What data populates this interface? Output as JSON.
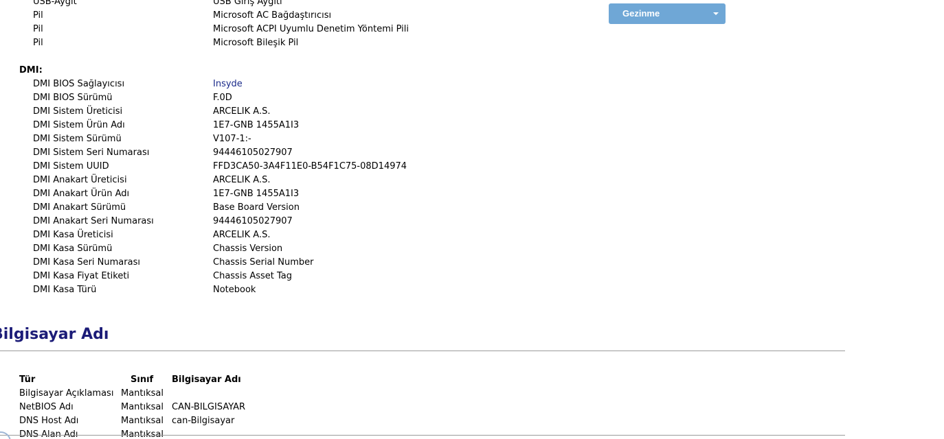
{
  "navigation": {
    "button_label": "Gezinme"
  },
  "devices": [
    {
      "key": "USB-Aygıt",
      "value": "USB Giriş Aygıtı"
    },
    {
      "key": "Pil",
      "value": "Microsoft AC Bağdaştırıcısı"
    },
    {
      "key": "Pil",
      "value": "Microsoft ACPI Uyumlu Denetim Yöntemi Pili"
    },
    {
      "key": "Pil",
      "value": "Microsoft Bileşik Pil"
    }
  ],
  "dmi": {
    "header": "DMI:",
    "items": [
      {
        "key": "DMI BIOS Sağlayıcısı",
        "value": "Insyde"
      },
      {
        "key": "DMI BIOS Sürümü",
        "value": "F.0D"
      },
      {
        "key": "DMI Sistem Üreticisi",
        "value": "ARCELIK A.S."
      },
      {
        "key": "DMI Sistem Ürün Adı",
        "value": "1E7-GNB 1455A1I3"
      },
      {
        "key": "DMI Sistem Sürümü",
        "value": "V107-1:-"
      },
      {
        "key": "DMI Sistem Seri Numarası",
        "value": "94446105027907"
      },
      {
        "key": "DMI Sistem UUID",
        "value": "FFD3CA50-3A4F11E0-B54F1C75-08D14974"
      },
      {
        "key": "DMI Anakart Üreticisi",
        "value": "ARCELIK A.S."
      },
      {
        "key": "DMI Anakart Ürün Adı",
        "value": "1E7-GNB 1455A1I3"
      },
      {
        "key": "DMI Anakart Sürümü",
        "value": "Base Board Version"
      },
      {
        "key": "DMI Anakart Seri Numarası",
        "value": "94446105027907"
      },
      {
        "key": "DMI Kasa Üreticisi",
        "value": "ARCELIK A.S."
      },
      {
        "key": "DMI Kasa Sürümü",
        "value": "Chassis Version"
      },
      {
        "key": "DMI Kasa Seri Numarası",
        "value": "Chassis Serial Number"
      },
      {
        "key": "DMI Kasa Fiyat Etiketi",
        "value": "Chassis Asset Tag"
      },
      {
        "key": "DMI Kasa Türü",
        "value": "Notebook"
      }
    ]
  },
  "computer_name": {
    "title": "Bilgisayar Adı",
    "columns": [
      "Tür",
      "Sınıf",
      "Bilgisayar Adı"
    ],
    "rows": [
      [
        "Bilgisayar Açıklaması",
        "Mantıksal",
        ""
      ],
      [
        "NetBIOS Adı",
        "Mantıksal",
        "CAN-BILGISAYAR"
      ],
      [
        "DNS Host Adı",
        "Mantıksal",
        "can-Bilgisayar"
      ],
      [
        "DNS Alan Adı",
        "Mantıksal",
        ""
      ]
    ]
  }
}
